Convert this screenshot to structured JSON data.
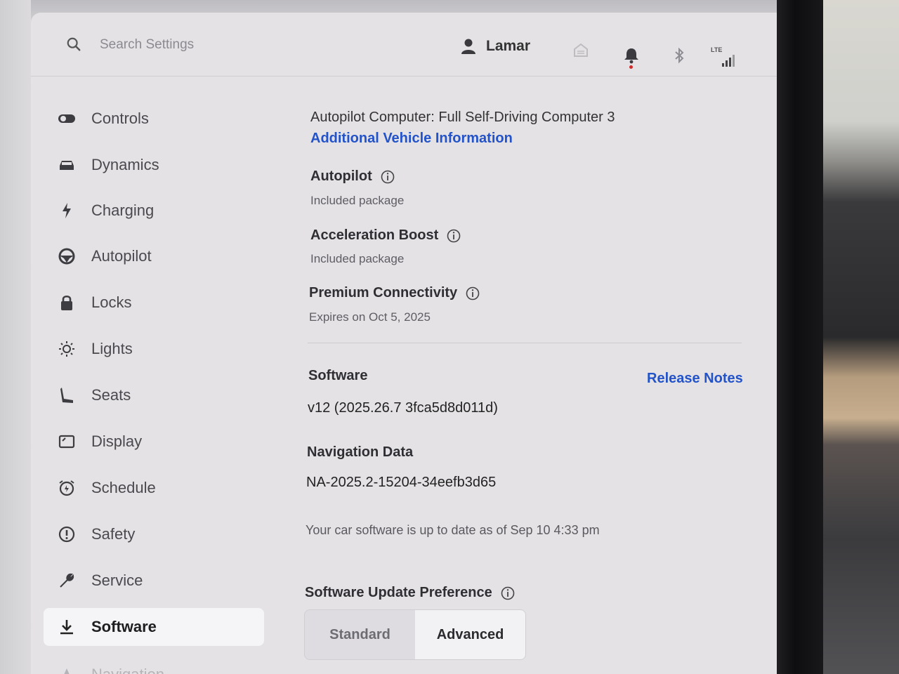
{
  "header": {
    "search_placeholder": "Search Settings",
    "user_name": "Lamar",
    "network_label": "LTE"
  },
  "sidebar": {
    "items": [
      {
        "label": "Controls",
        "icon": "toggle-icon"
      },
      {
        "label": "Dynamics",
        "icon": "car-icon"
      },
      {
        "label": "Charging",
        "icon": "bolt-icon"
      },
      {
        "label": "Autopilot",
        "icon": "steering-wheel-icon"
      },
      {
        "label": "Locks",
        "icon": "lock-icon"
      },
      {
        "label": "Lights",
        "icon": "sun-icon"
      },
      {
        "label": "Seats",
        "icon": "seat-icon"
      },
      {
        "label": "Display",
        "icon": "display-icon"
      },
      {
        "label": "Schedule",
        "icon": "alarm-clock-icon"
      },
      {
        "label": "Safety",
        "icon": "alert-circle-icon"
      },
      {
        "label": "Service",
        "icon": "wrench-icon"
      },
      {
        "label": "Software",
        "icon": "download-icon",
        "active": true
      },
      {
        "label": "Navigation",
        "icon": "navigation-icon"
      }
    ]
  },
  "main": {
    "autopilot_computer": "Autopilot Computer: Full Self-Driving Computer 3",
    "vehicle_info_link": "Additional Vehicle Information",
    "packages": [
      {
        "name": "Autopilot",
        "status": "Included package"
      },
      {
        "name": "Acceleration Boost",
        "status": "Included package"
      },
      {
        "name": "Premium Connectivity",
        "status": "Expires on Oct 5, 2025"
      }
    ],
    "software_label": "Software",
    "release_notes_link": "Release Notes",
    "software_version": "v12 (2025.26.7 3fca5d8d011d)",
    "navigation_data_label": "Navigation Data",
    "navigation_data_version": "NA-2025.2-15204-34eefb3d65",
    "update_status": "Your car software is up to date as of Sep 10 4:33 pm",
    "update_preference_label": "Software Update Preference",
    "update_options": [
      "Standard",
      "Advanced"
    ],
    "selected_option": "Advanced"
  },
  "colors": {
    "link": "#2353c9",
    "notification_dot": "#d12a2a",
    "panel": "#e4e2e5"
  }
}
